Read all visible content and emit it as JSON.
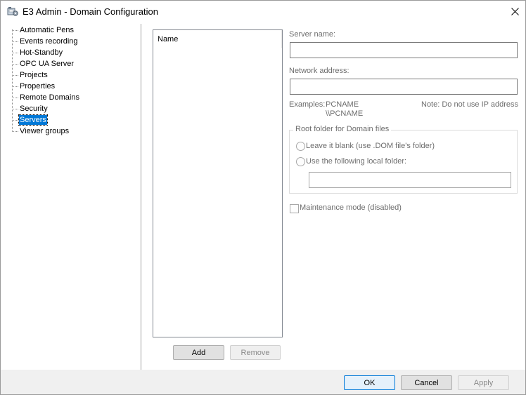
{
  "window": {
    "title": "E3 Admin - Domain Configuration",
    "app_icon": "e3-admin-icon",
    "close_icon": "close-icon"
  },
  "tree": {
    "items": [
      {
        "label": "Automatic Pens",
        "selected": false
      },
      {
        "label": "Events recording",
        "selected": false
      },
      {
        "label": "Hot-Standby",
        "selected": false
      },
      {
        "label": "OPC UA Server",
        "selected": false
      },
      {
        "label": "Projects",
        "selected": false
      },
      {
        "label": "Properties",
        "selected": false
      },
      {
        "label": "Remote Domains",
        "selected": false
      },
      {
        "label": "Security",
        "selected": false
      },
      {
        "label": "Servers",
        "selected": true
      },
      {
        "label": "Viewer groups",
        "selected": false
      }
    ]
  },
  "servers_list": {
    "column_header": "Name",
    "rows": [],
    "add_label": "Add",
    "remove_label": "Remove"
  },
  "server_form": {
    "server_name_label": "Server name:",
    "server_name_value": "",
    "network_address_label": "Network address:",
    "network_address_value": "",
    "examples_label": "Examples:",
    "example_1": "PCNAME",
    "example_2": "\\\\PCNAME",
    "note": "Note: Do not use IP address",
    "root_folder": {
      "title": "Root folder for Domain files",
      "option_blank": "Leave it blank (use .DOM file's folder)",
      "option_local": "Use the following local folder:",
      "local_folder_value": ""
    },
    "maintenance_label": "Maintenance mode (disabled)"
  },
  "footer": {
    "ok_label": "OK",
    "cancel_label": "Cancel",
    "apply_label": "Apply"
  }
}
